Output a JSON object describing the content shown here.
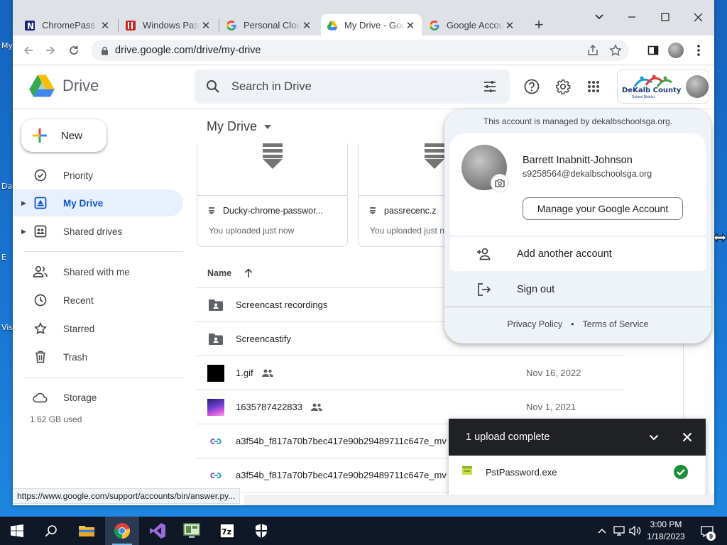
{
  "desktop": {
    "labels": [
      "My",
      "Da",
      "E",
      "Vis"
    ]
  },
  "browser": {
    "tabs": [
      {
        "title": "ChromePass - Chr",
        "icon": "nirsoft-icon"
      },
      {
        "title": "Windows Passwor",
        "icon": "nirsoft-red-icon"
      },
      {
        "title": "Personal Cloud",
        "icon": "google-icon"
      },
      {
        "title": "My Drive - Goog",
        "icon": "drive-icon",
        "active": true
      },
      {
        "title": "Google Account",
        "icon": "google-icon"
      }
    ],
    "url": "drive.google.com/drive/my-drive",
    "status_url": "https://www.google.com/support/accounts/bin/answer.py..."
  },
  "drive": {
    "app_name": "Drive",
    "search_placeholder": "Search in Drive",
    "org_name": "DeKalb County",
    "org_sub": "School District",
    "new_label": "New",
    "nav": [
      {
        "label": "Priority",
        "icon": "priority-icon"
      },
      {
        "label": "My Drive",
        "icon": "my-drive-icon",
        "selected": true
      },
      {
        "label": "Shared drives",
        "icon": "shared-drives-icon"
      },
      {
        "label": "Shared with me",
        "icon": "shared-with-me-icon"
      },
      {
        "label": "Recent",
        "icon": "clock-icon"
      },
      {
        "label": "Starred",
        "icon": "star-icon"
      },
      {
        "label": "Trash",
        "icon": "trash-icon"
      },
      {
        "label": "Storage",
        "icon": "cloud-icon"
      }
    ],
    "storage_used": "1.62 GB used",
    "title": "My Drive",
    "suggested": [
      {
        "name": "Ducky-chrome-passwor...",
        "sub": "You uploaded just now"
      },
      {
        "name": "passrecenc.z",
        "sub": "You uploaded just n"
      }
    ],
    "list_header": "Name",
    "files": [
      {
        "name": "Screencast recordings",
        "date": "",
        "type": "shared-folder",
        "shared": false
      },
      {
        "name": "Screencastify",
        "date": "",
        "type": "shared-folder",
        "shared": false
      },
      {
        "name": "1.gif",
        "date": "Nov 16, 2022",
        "type": "image-black",
        "shared": true
      },
      {
        "name": "1635787422833",
        "date": "Nov 1, 2021",
        "type": "image-purple",
        "shared": true
      },
      {
        "name": "a3f54b_f817a70b7bec417e90b29489711c647e_mv",
        "date": "",
        "type": "link",
        "shared": false
      },
      {
        "name": "a3f54b_f817a70b7bec417e90b29489711c647e_mv",
        "date": "",
        "type": "link",
        "shared": false
      }
    ]
  },
  "account": {
    "managed_by": "This account is managed by dekalbschoolsga.org.",
    "name": "Barrett Inabnitt-Johnson",
    "email": "s9258564@dekalbschoolsga.org",
    "manage_label": "Manage your Google Account",
    "add_account": "Add another account",
    "sign_out": "Sign out",
    "privacy": "Privacy Policy",
    "terms": "Terms of Service"
  },
  "upload": {
    "title": "1 upload complete",
    "file": "PstPassword.exe"
  },
  "taskbar": {
    "time": "3:00 PM",
    "date": "1/18/2023",
    "notifications": "9"
  },
  "colors": {
    "accent": "#0b57d0",
    "selected_bg": "#e8f0fe",
    "success": "#1e8e3e"
  }
}
